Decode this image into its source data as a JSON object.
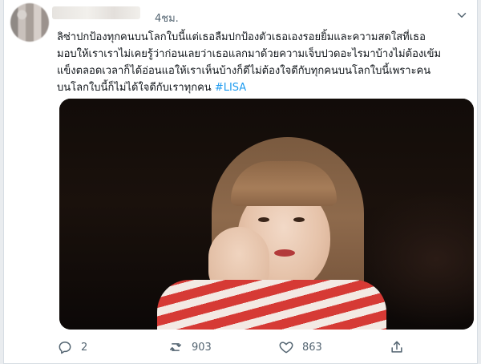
{
  "tweet": {
    "time": "4ชม.",
    "text": "ลิซ่าปกป้องทุกคนบนโลกใบนี้แต่เธอลืมปกป้องตัวเธอเองรอยยิ้มและความสดใสที่เธอ\nมอบให้เราเราไม่เคยรู้ว่าก่อนเลยว่าเธอแลกมาด้วยความเจ็บปวดอะไรมาบ้างไม่ต้องเข้ม\nแข็งตลอดเวลาก็ได้อ่อนแอให้เราเห็นบ้างก็ดีไม่ต้องใจดีกับทุกคนบนโลกใบนี้เพราะคน\nบนโลกใบนี้ก็ไม่ได้ใจดีกับเราทุกคน ",
    "hashtag": "#LISA",
    "actions": {
      "reply_count": "2",
      "retweet_count": "903",
      "like_count": "863"
    }
  },
  "icons": {
    "caret": "chevron-down-icon",
    "reply": "reply-icon",
    "retweet": "retweet-icon",
    "like": "heart-icon",
    "share": "share-icon"
  },
  "colors": {
    "text": "#0f1419",
    "secondary": "#536471",
    "link": "#1d9bf0"
  }
}
